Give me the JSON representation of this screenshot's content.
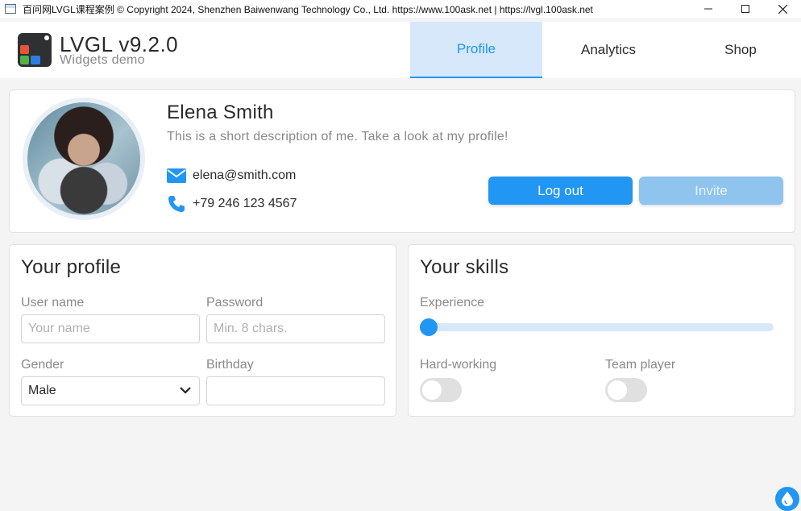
{
  "window": {
    "title": "百问网LVGL课程案例  © Copyright 2024, Shenzhen Baiwenwang Technology Co., Ltd.   https://www.100ask.net | https://lvgl.100ask.net"
  },
  "header": {
    "brand_title": "LVGL v9.2.0",
    "brand_subtitle": "Widgets demo",
    "tabs": [
      {
        "label": "Profile",
        "active": true
      },
      {
        "label": "Analytics",
        "active": false
      },
      {
        "label": "Shop",
        "active": false
      }
    ]
  },
  "profile": {
    "name": "Elena Smith",
    "description": "This is a short description of me. Take a look at my profile!",
    "email": "elena@smith.com",
    "phone": "+79 246 123 4567",
    "logout_label": "Log out",
    "invite_label": "Invite"
  },
  "your_profile": {
    "title": "Your profile",
    "username_label": "User name",
    "username_placeholder": "Your name",
    "password_label": "Password",
    "password_placeholder": "Min. 8 chars.",
    "gender_label": "Gender",
    "gender_value": "Male",
    "birthday_label": "Birthday",
    "birthday_value": ""
  },
  "your_skills": {
    "title": "Your skills",
    "experience_label": "Experience",
    "experience_value": 0,
    "hard_working_label": "Hard-working",
    "hard_working_on": false,
    "team_player_label": "Team player",
    "team_player_on": false
  },
  "colors": {
    "accent": "#2196f3",
    "accent_light": "#d6e8fa",
    "background": "#f4f4f4"
  }
}
